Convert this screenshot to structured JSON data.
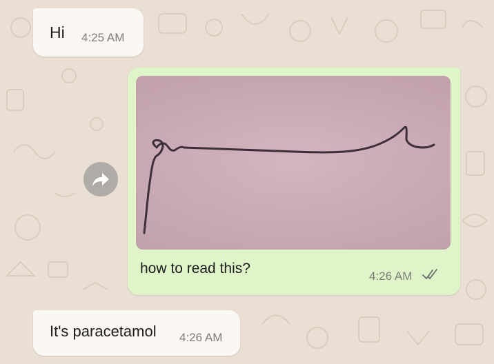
{
  "messages": [
    {
      "direction": "incoming",
      "text": "Hi",
      "time": "4:25 AM"
    },
    {
      "direction": "outgoing",
      "type": "image",
      "caption": "how to read this?",
      "time": "4:26 AM",
      "status": "read"
    },
    {
      "direction": "incoming",
      "text": "It's paracetamol",
      "time": "4:26 AM"
    }
  ],
  "icons": {
    "forward": "forward-arrow-icon",
    "read_receipt": "double-check-icon"
  },
  "colors": {
    "chat_background": "#eadfd3",
    "incoming_bubble": "#fbf7f3",
    "outgoing_bubble": "#dff5c9",
    "read_ticks": "#6c6c6c",
    "ink": "#3c2f3a"
  }
}
